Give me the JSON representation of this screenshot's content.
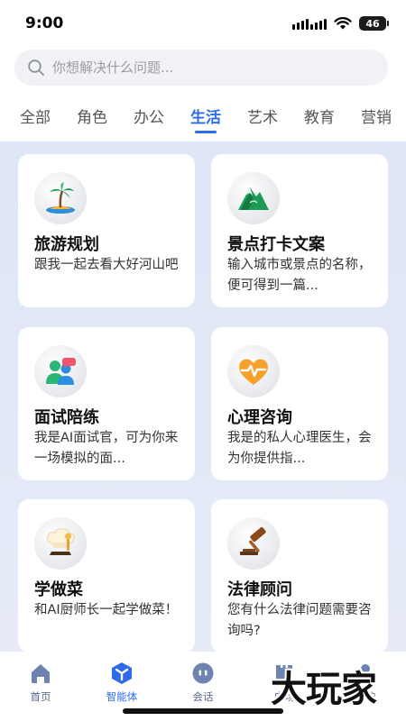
{
  "status_bar": {
    "time": "9:00",
    "battery": "46"
  },
  "search": {
    "placeholder": "你想解决什么问题..."
  },
  "tabs": [
    {
      "label": "全部"
    },
    {
      "label": "角色"
    },
    {
      "label": "办公"
    },
    {
      "label": "生活",
      "active": true
    },
    {
      "label": "艺术"
    },
    {
      "label": "教育"
    },
    {
      "label": "营销"
    }
  ],
  "cards": [
    {
      "icon": "palm-island-icon",
      "title": "旅游规划",
      "description": "跟我一起去看大好河山吧"
    },
    {
      "icon": "mountain-icon",
      "title": "景点打卡文案",
      "description": "输入城市或景点的名称，便可得到一篇..."
    },
    {
      "icon": "chat-people-icon",
      "title": "面试陪练",
      "description": "我是AI面试官，可为你来一场模拟的面..."
    },
    {
      "icon": "heart-pulse-icon",
      "title": "心理咨询",
      "description": "我是的私人心理医生，会为你提供指..."
    },
    {
      "icon": "chef-hat-icon",
      "title": "学做菜",
      "description": "和AI厨师长一起学做菜！"
    },
    {
      "icon": "gavel-icon",
      "title": "法律顾问",
      "description": "您有什么法律问题需要咨询吗?"
    }
  ],
  "bottom_nav": [
    {
      "icon": "home-icon",
      "label": "首页"
    },
    {
      "icon": "agent-cube-icon",
      "label": "智能体",
      "active": true
    },
    {
      "icon": "chat-bubble-icon",
      "label": "会话"
    },
    {
      "icon": "square-icon",
      "label": "广场"
    },
    {
      "icon": "profile-icon",
      "label": "我的"
    }
  ],
  "watermark": "大玩家",
  "colors": {
    "accent": "#2e6bea",
    "content_bg": "#dfe6f6",
    "nav_icon": "#6f83b0"
  }
}
